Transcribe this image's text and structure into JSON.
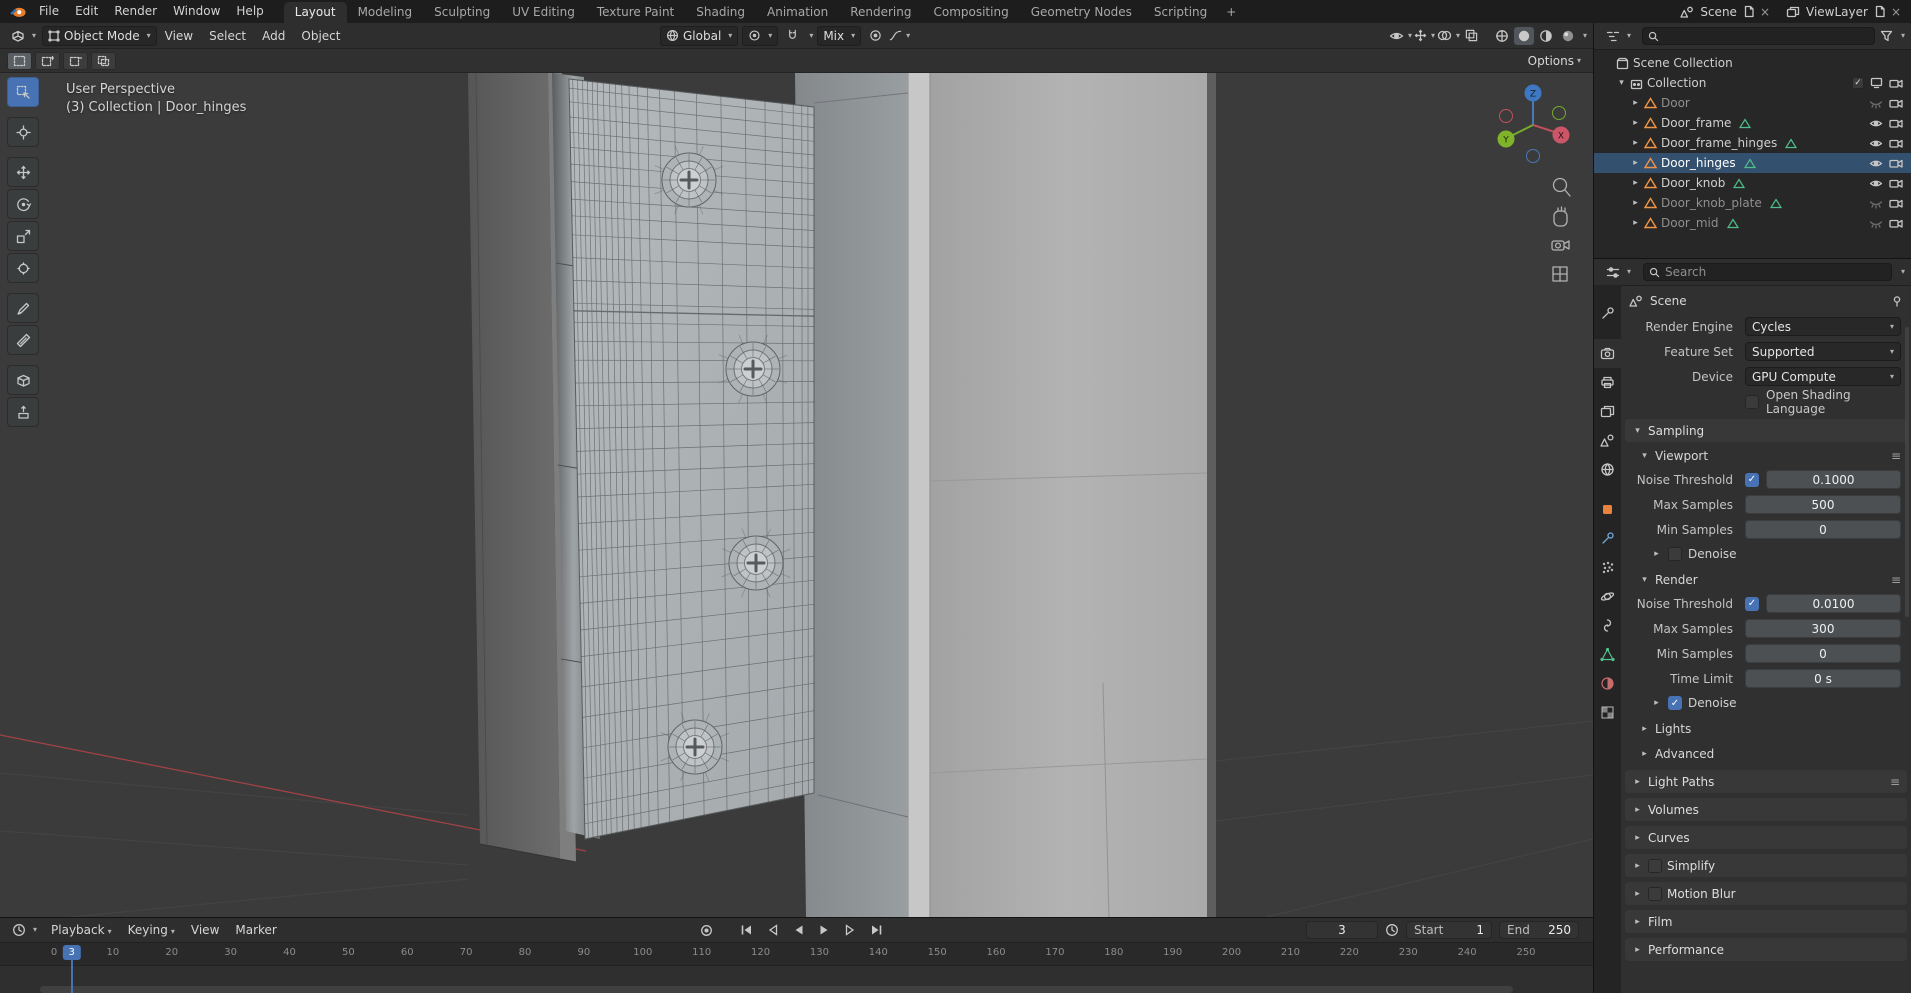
{
  "topbar": {
    "menus": [
      "File",
      "Edit",
      "Render",
      "Window",
      "Help"
    ],
    "tabs": [
      {
        "label": "Layout",
        "active": true
      },
      {
        "label": "Modeling",
        "active": false
      },
      {
        "label": "Sculpting",
        "active": false
      },
      {
        "label": "UV Editing",
        "active": false
      },
      {
        "label": "Texture Paint",
        "active": false
      },
      {
        "label": "Shading",
        "active": false
      },
      {
        "label": "Animation",
        "active": false
      },
      {
        "label": "Rendering",
        "active": false
      },
      {
        "label": "Compositing",
        "active": false
      },
      {
        "label": "Geometry Nodes",
        "active": false
      },
      {
        "label": "Scripting",
        "active": false
      }
    ],
    "add_tab_label": "+",
    "scene_selector_label": "Scene",
    "viewlayer_selector_label": "ViewLayer"
  },
  "viewport_header": {
    "mode_label": "Object Mode",
    "menus": [
      "View",
      "Select",
      "Add",
      "Object"
    ],
    "orientation_label": "Global",
    "falloff_label": "Mix",
    "options_label": "Options"
  },
  "tool_settings": {
    "select_modes": [
      "new",
      "extend",
      "subtract",
      "intersect"
    ]
  },
  "tools": [
    "select-box",
    "cursor",
    "move",
    "rotate",
    "scale",
    "transform",
    "annotate",
    "measure",
    "add-cube",
    "extrude"
  ],
  "viewport": {
    "overlay_line1": "User Perspective",
    "overlay_line2": "(3) Collection | Door_hinges",
    "gizmo_axis_x": "X",
    "gizmo_axis_y": "Y",
    "gizmo_axis_z": "Z"
  },
  "outliner": {
    "rows": [
      {
        "label": "Scene Collection",
        "icon": "scene-collection",
        "depth": 0,
        "caret": "",
        "right": []
      },
      {
        "label": "Collection",
        "icon": "collection",
        "depth": 1,
        "caret": "open",
        "right": [
          "checkbox",
          "screen",
          "camera"
        ]
      },
      {
        "label": "Door",
        "icon": "mesh",
        "depth": 2,
        "caret": "closed",
        "dim": true,
        "right": [
          "eye-closed",
          "camera"
        ]
      },
      {
        "label": "Door_frame",
        "icon": "mesh",
        "depth": 2,
        "caret": "closed",
        "nodes": true,
        "right": [
          "eye",
          "camera"
        ]
      },
      {
        "label": "Door_frame_hinges",
        "icon": "mesh",
        "depth": 2,
        "caret": "closed",
        "nodes": true,
        "right": [
          "eye",
          "camera"
        ]
      },
      {
        "label": "Door_hinges",
        "icon": "mesh",
        "depth": 2,
        "caret": "closed",
        "selected": true,
        "nodes": true,
        "right": [
          "eye",
          "camera"
        ]
      },
      {
        "label": "Door_knob",
        "icon": "mesh",
        "depth": 2,
        "caret": "closed",
        "nodes": true,
        "right": [
          "eye",
          "camera"
        ]
      },
      {
        "label": "Door_knob_plate",
        "icon": "mesh",
        "depth": 2,
        "caret": "closed",
        "dim": true,
        "nodes": true,
        "right": [
          "eye-closed",
          "camera"
        ]
      },
      {
        "label": "Door_mid",
        "icon": "mesh",
        "depth": 2,
        "caret": "closed",
        "dim": true,
        "nodes": true,
        "right": [
          "eye-closed",
          "camera"
        ]
      }
    ]
  },
  "properties": {
    "search_placeholder": "Search",
    "breadcrumb": "Scene",
    "tabs": [
      "tool",
      "render",
      "output",
      "view-layer",
      "scene",
      "world",
      "object",
      "modifiers",
      "particles",
      "physics",
      "constraints",
      "object-data",
      "material",
      "texture"
    ],
    "active_tab": "render",
    "render_engine_label": "Render Engine",
    "render_engine_value": "Cycles",
    "feature_set_label": "Feature Set",
    "feature_set_value": "Supported",
    "device_label": "Device",
    "device_value": "GPU Compute",
    "osl_label": "Open Shading Language",
    "sampling": {
      "title": "Sampling",
      "viewport": {
        "title": "Viewport",
        "noise_threshold_label": "Noise Threshold",
        "noise_threshold_value": "0.1000",
        "max_samples_label": "Max Samples",
        "max_samples_value": "500",
        "min_samples_label": "Min Samples",
        "min_samples_value": "0",
        "denoise_label": "Denoise"
      },
      "render": {
        "title": "Render",
        "noise_threshold_label": "Noise Threshold",
        "noise_threshold_value": "0.0100",
        "max_samples_label": "Max Samples",
        "max_samples_value": "300",
        "min_samples_label": "Min Samples",
        "min_samples_value": "0",
        "time_limit_label": "Time Limit",
        "time_limit_value": "0 s",
        "denoise_label": "Denoise"
      },
      "lights_label": "Lights",
      "advanced_label": "Advanced"
    },
    "sections": [
      "Light Paths",
      "Volumes",
      "Curves",
      "Simplify",
      "Motion Blur",
      "Film",
      "Performance"
    ]
  },
  "timeline": {
    "menus": [
      "Playback",
      "Keying",
      "View",
      "Marker"
    ],
    "current_frame": "3",
    "frame_field_value": "3",
    "start_label": "Start",
    "start_value": "1",
    "end_label": "End",
    "end_value": "250",
    "ticks": [
      "0",
      "10",
      "20",
      "30",
      "40",
      "50",
      "60",
      "70",
      "80",
      "90",
      "100",
      "110",
      "120",
      "130",
      "140",
      "150",
      "160",
      "170",
      "180",
      "190",
      "200",
      "210",
      "220",
      "230",
      "240",
      "250"
    ]
  },
  "colors": {
    "accent": "#4772b3",
    "selection_row": "#33506e",
    "mesh_icon_orange": "#ef9445",
    "data_icon_green": "#4fbe8b",
    "axis_x_red": "#c0505c",
    "axis_y_green": "#76ab2d",
    "axis_z_blue": "#3f78c2"
  },
  "icons": {
    "blender-logo": "orange blender mark",
    "search-icon": "magnifier",
    "filter-icon": "funnel",
    "eye-icon": "visibility eye",
    "eye-closed-icon": "hidden eye",
    "camera-icon": "render visibility camera",
    "screen-icon": "display visibility",
    "magnet-icon": "snap magnet",
    "globe-icon": "orientation globe",
    "pivot-icon": "pivot point",
    "proportional-icon": "proportional editing circle",
    "falloff-curve-icon": "falloff curve",
    "clock-icon": "timeline clock",
    "pin-icon": "pin",
    "preset-menu-icon": "panel menu lines",
    "x-icon": "unlink cross",
    "new-icon": "new datablock"
  }
}
